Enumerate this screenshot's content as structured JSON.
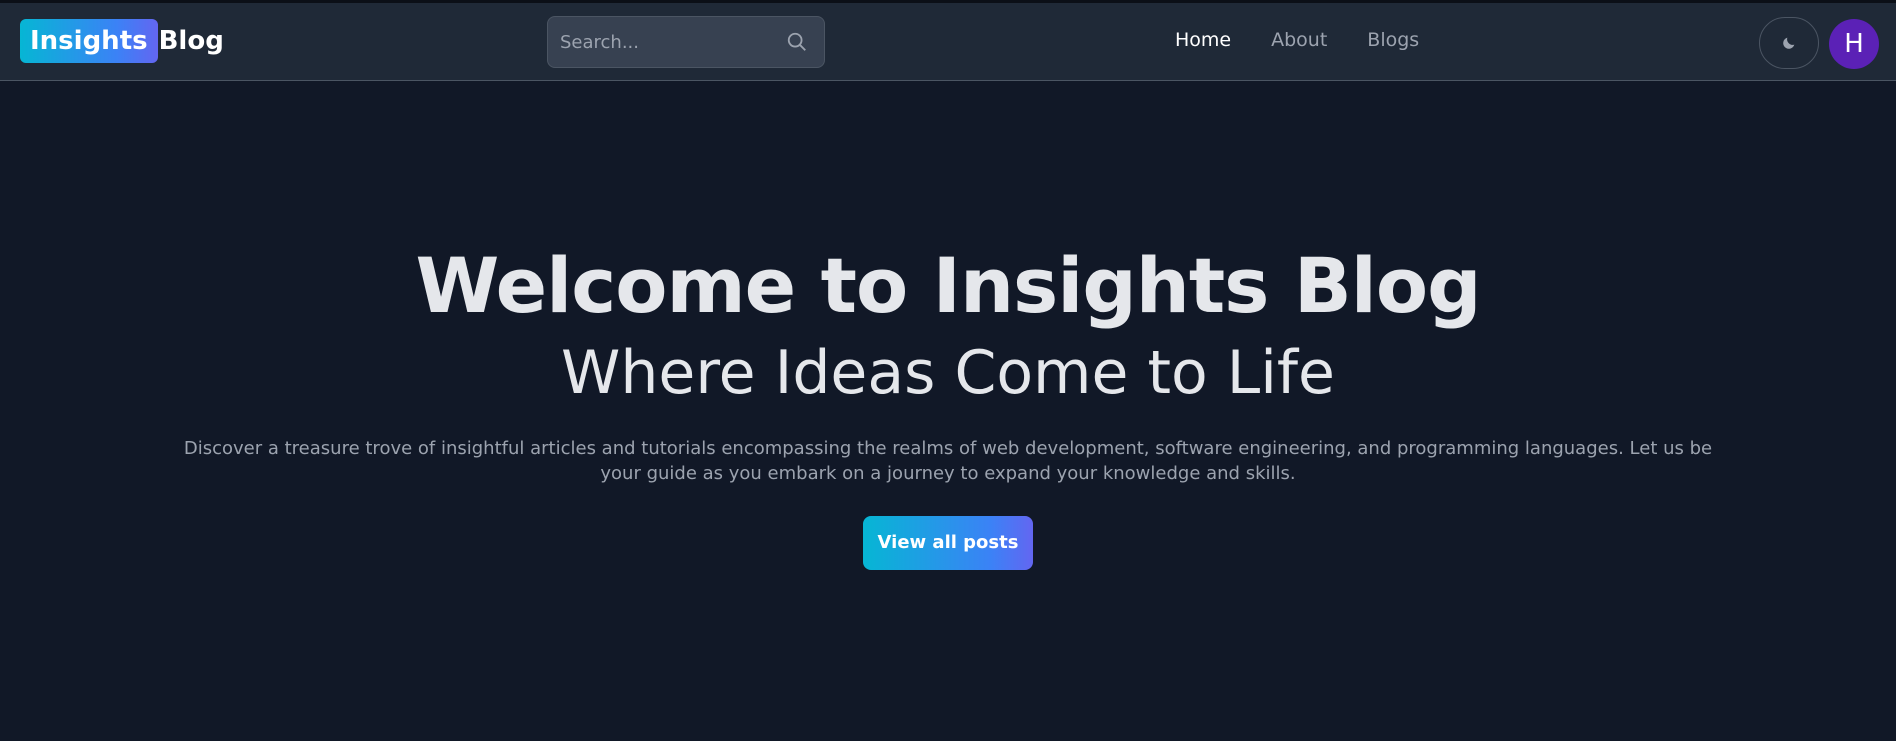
{
  "brand": {
    "badge_text": "Insights",
    "text": "Blog"
  },
  "search": {
    "placeholder": "Search...",
    "icon": "search-icon"
  },
  "nav": {
    "items": [
      {
        "label": "Home",
        "active": true
      },
      {
        "label": "About",
        "active": false
      },
      {
        "label": "Blogs",
        "active": false
      }
    ]
  },
  "theme_toggle": {
    "icon": "moon-icon"
  },
  "user": {
    "avatar_initial": "H"
  },
  "hero": {
    "title": "Welcome to Insights Blog",
    "subtitle": "Where Ideas Come to Life",
    "description": "Discover a treasure trove of insightful articles and tutorials encompassing the realms of web development, software engineering, and programming languages. Let us be your guide as you embark on a journey to expand your knowledge and skills.",
    "cta_label": "View all posts"
  },
  "colors": {
    "background": "#111827",
    "navbar": "#1f2937",
    "accent_gradient_start": "#06b6d4",
    "accent_gradient_end": "#6366f1",
    "avatar": "#5b21b6"
  }
}
